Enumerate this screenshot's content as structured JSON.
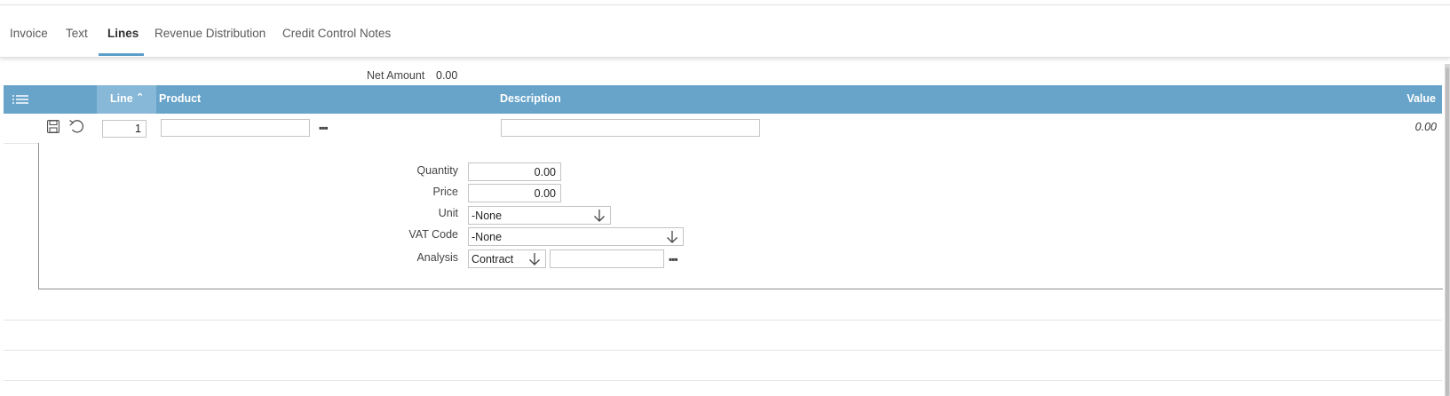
{
  "tabs": [
    {
      "label": "Invoice"
    },
    {
      "label": "Text"
    },
    {
      "label": "Lines"
    },
    {
      "label": "Revenue Distribution"
    },
    {
      "label": "Credit Control Notes"
    }
  ],
  "active_tab": "Lines",
  "summary": {
    "net_amount_label": "Net Amount",
    "net_amount_value": "0.00"
  },
  "grid": {
    "columns": {
      "line": "Line",
      "product": "Product",
      "description": "Description",
      "value": "Value"
    },
    "sort_indicator": "^",
    "row": {
      "line": "1",
      "product": "",
      "description": "",
      "value": "0.00"
    }
  },
  "detail": {
    "quantity_label": "Quantity",
    "quantity_value": "0.00",
    "price_label": "Price",
    "price_value": "0.00",
    "unit_label": "Unit",
    "unit_value": "-None",
    "vat_label": "VAT Code",
    "vat_value": "-None",
    "analysis_label": "Analysis",
    "analysis_value": "Contract",
    "analysis_code": ""
  },
  "lookup_glyph": "▪▪▪",
  "icons": [
    "list-menu-icon",
    "save-icon",
    "undo-icon",
    "arrow-down-icon",
    "ellipsis-icon"
  ],
  "colors": {
    "header": "#68a4c9",
    "header_sorted": "#87b8d7",
    "tab_underline": "#5b9ec9"
  }
}
